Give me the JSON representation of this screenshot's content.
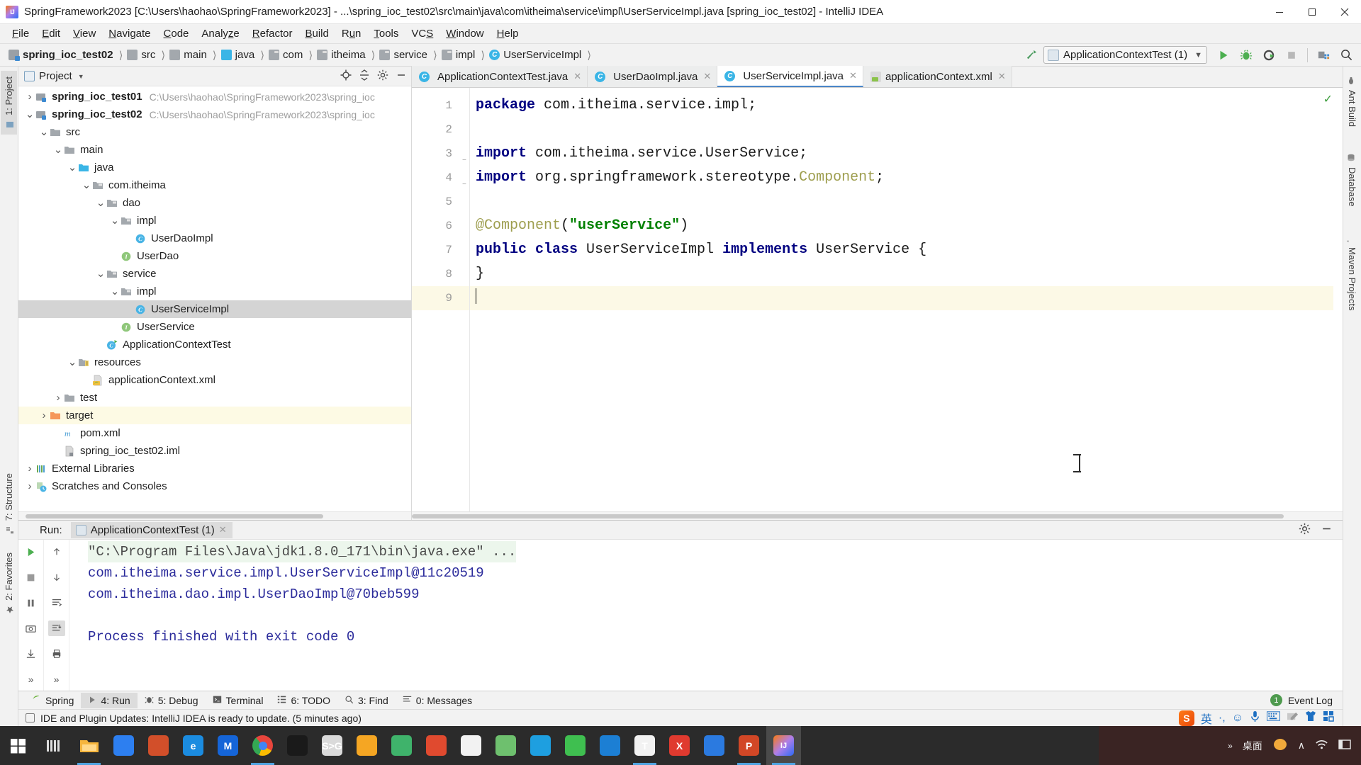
{
  "window": {
    "title": "SpringFramework2023 [C:\\Users\\haohao\\SpringFramework2023] - ...\\spring_ioc_test02\\src\\main\\java\\com\\itheima\\service\\impl\\UserServiceImpl.java [spring_ioc_test02] - IntelliJ IDEA",
    "logo_icon": "intellij-idea-logo",
    "minimize_icon": "minimize-icon",
    "maximize_icon": "maximize-icon",
    "close_icon": "close-icon"
  },
  "menu": [
    {
      "label": "File",
      "mnemonic": "F"
    },
    {
      "label": "Edit",
      "mnemonic": "E"
    },
    {
      "label": "View",
      "mnemonic": "V"
    },
    {
      "label": "Navigate",
      "mnemonic": "N"
    },
    {
      "label": "Code",
      "mnemonic": "C"
    },
    {
      "label": "Analyze",
      "mnemonic": "z"
    },
    {
      "label": "Refactor",
      "mnemonic": "R"
    },
    {
      "label": "Build",
      "mnemonic": "B"
    },
    {
      "label": "Run",
      "mnemonic": "u"
    },
    {
      "label": "Tools",
      "mnemonic": "T"
    },
    {
      "label": "VCS",
      "mnemonic": "S"
    },
    {
      "label": "Window",
      "mnemonic": "W"
    },
    {
      "label": "Help",
      "mnemonic": "H"
    }
  ],
  "navbar": {
    "breadcrumbs": [
      {
        "label": "spring_ioc_test02",
        "icon": "module-icon",
        "bold": true
      },
      {
        "label": "src",
        "icon": "folder-icon",
        "bold": false
      },
      {
        "label": "main",
        "icon": "folder-icon",
        "bold": false
      },
      {
        "label": "java",
        "icon": "source-folder-icon",
        "bold": false
      },
      {
        "label": "com",
        "icon": "package-icon",
        "bold": false
      },
      {
        "label": "itheima",
        "icon": "package-icon",
        "bold": false
      },
      {
        "label": "service",
        "icon": "package-icon",
        "bold": false
      },
      {
        "label": "impl",
        "icon": "package-icon",
        "bold": false
      },
      {
        "label": "UserServiceImpl",
        "icon": "class-icon",
        "bold": false
      }
    ],
    "build_icon": "hammer-icon",
    "run_config": {
      "name": "ApplicationContextTest (1)",
      "icon": "run-config-icon",
      "dropdown_icon": "chevron-down-icon"
    },
    "actions": [
      {
        "name": "run-button",
        "icon": "run-icon"
      },
      {
        "name": "debug-button",
        "icon": "debug-icon"
      },
      {
        "name": "run-with-coverage-button",
        "icon": "coverage-icon"
      },
      {
        "name": "stop-button",
        "icon": "stop-icon"
      },
      {
        "name": "project-structure-button",
        "icon": "project-structure-icon"
      },
      {
        "name": "search-everywhere-button",
        "icon": "search-icon"
      }
    ]
  },
  "left_rail": [
    {
      "label": "1: Project",
      "icon": "project-icon",
      "active": true
    },
    {
      "label": "7: Structure",
      "icon": "structure-icon",
      "active": false
    },
    {
      "label": "2: Favorites",
      "icon": "favorites-icon",
      "active": false
    }
  ],
  "right_rail": [
    {
      "label": "Ant Build",
      "icon": "ant-icon"
    },
    {
      "label": "Database",
      "icon": "database-icon"
    },
    {
      "label": "Maven Projects",
      "icon": "maven-icon"
    }
  ],
  "project_panel": {
    "title": "Project",
    "title_icon": "project-view-icon",
    "dropdown_icon": "chevron-down-icon",
    "actions": [
      {
        "name": "select-opened-file-button",
        "icon": "target-icon"
      },
      {
        "name": "collapse-all-button",
        "icon": "collapse-all-icon"
      },
      {
        "name": "settings-button",
        "icon": "gear-icon"
      },
      {
        "name": "hide-button",
        "icon": "minus-icon"
      }
    ],
    "tree": [
      {
        "label": "spring_ioc_test01",
        "path": "C:\\Users\\haohao\\SpringFramework2023\\spring_ioc",
        "indent": 0,
        "arrow": "collapsed",
        "icon": "module-icon",
        "bold": true,
        "state": "normal"
      },
      {
        "label": "spring_ioc_test02",
        "path": "C:\\Users\\haohao\\SpringFramework2023\\spring_ioc",
        "indent": 0,
        "arrow": "expanded",
        "icon": "module-icon",
        "bold": true,
        "state": "normal"
      },
      {
        "label": "src",
        "path": "",
        "indent": 1,
        "arrow": "expanded",
        "icon": "folder-icon",
        "bold": false,
        "state": "normal"
      },
      {
        "label": "main",
        "path": "",
        "indent": 2,
        "arrow": "expanded",
        "icon": "folder-icon",
        "bold": false,
        "state": "normal"
      },
      {
        "label": "java",
        "path": "",
        "indent": 3,
        "arrow": "expanded",
        "icon": "source-folder-icon",
        "bold": false,
        "state": "normal"
      },
      {
        "label": "com.itheima",
        "path": "",
        "indent": 4,
        "arrow": "expanded",
        "icon": "package-icon",
        "bold": false,
        "state": "normal"
      },
      {
        "label": "dao",
        "path": "",
        "indent": 5,
        "arrow": "expanded",
        "icon": "package-icon",
        "bold": false,
        "state": "normal"
      },
      {
        "label": "impl",
        "path": "",
        "indent": 6,
        "arrow": "expanded",
        "icon": "package-icon",
        "bold": false,
        "state": "normal"
      },
      {
        "label": "UserDaoImpl",
        "path": "",
        "indent": 7,
        "arrow": "none",
        "icon": "class-icon",
        "bold": false,
        "state": "normal"
      },
      {
        "label": "UserDao",
        "path": "",
        "indent": 6,
        "arrow": "none",
        "icon": "interface-icon",
        "bold": false,
        "state": "normal"
      },
      {
        "label": "service",
        "path": "",
        "indent": 5,
        "arrow": "expanded",
        "icon": "package-icon",
        "bold": false,
        "state": "normal"
      },
      {
        "label": "impl",
        "path": "",
        "indent": 6,
        "arrow": "expanded",
        "icon": "package-icon",
        "bold": false,
        "state": "normal"
      },
      {
        "label": "UserServiceImpl",
        "path": "",
        "indent": 7,
        "arrow": "none",
        "icon": "class-icon",
        "bold": false,
        "state": "selected"
      },
      {
        "label": "UserService",
        "path": "",
        "indent": 6,
        "arrow": "none",
        "icon": "interface-icon",
        "bold": false,
        "state": "normal"
      },
      {
        "label": "ApplicationContextTest",
        "path": "",
        "indent": 5,
        "arrow": "none",
        "icon": "runnable-class-icon",
        "bold": false,
        "state": "normal"
      },
      {
        "label": "resources",
        "path": "",
        "indent": 3,
        "arrow": "expanded",
        "icon": "resources-folder-icon",
        "bold": false,
        "state": "normal"
      },
      {
        "label": "applicationContext.xml",
        "path": "",
        "indent": 4,
        "arrow": "none",
        "icon": "spring-xml-icon",
        "bold": false,
        "state": "normal"
      },
      {
        "label": "test",
        "path": "",
        "indent": 2,
        "arrow": "collapsed",
        "icon": "folder-icon",
        "bold": false,
        "state": "normal"
      },
      {
        "label": "target",
        "path": "",
        "indent": 1,
        "arrow": "collapsed",
        "icon": "excluded-folder-icon",
        "bold": false,
        "state": "highlight"
      },
      {
        "label": "pom.xml",
        "path": "",
        "indent": 2,
        "arrow": "none",
        "icon": "maven-pom-icon",
        "bold": false,
        "state": "normal"
      },
      {
        "label": "spring_ioc_test02.iml",
        "path": "",
        "indent": 2,
        "arrow": "none",
        "icon": "iml-file-icon",
        "bold": false,
        "state": "normal"
      },
      {
        "label": "External Libraries",
        "path": "",
        "indent": 0,
        "arrow": "collapsed",
        "icon": "libraries-icon",
        "bold": false,
        "state": "normal"
      },
      {
        "label": "Scratches and Consoles",
        "path": "",
        "indent": 0,
        "arrow": "collapsed",
        "icon": "scratches-icon",
        "bold": false,
        "state": "normal"
      }
    ]
  },
  "editor": {
    "tabs": [
      {
        "label": "ApplicationContextTest.java",
        "icon": "runnable-class-icon",
        "active": false
      },
      {
        "label": "UserDaoImpl.java",
        "icon": "class-icon",
        "active": false
      },
      {
        "label": "UserServiceImpl.java",
        "icon": "class-icon",
        "active": true
      },
      {
        "label": "applicationContext.xml",
        "icon": "spring-xml-icon",
        "active": false
      }
    ],
    "inspection_icon": "inspection-ok-icon",
    "line_numbers": [
      "1",
      "2",
      "3",
      "4",
      "5",
      "6",
      "7",
      "8",
      "9"
    ],
    "current_line": 9,
    "lines": [
      {
        "n": 1,
        "tokens": [
          {
            "t": "package",
            "c": "kw"
          },
          {
            "t": " com.itheima.service.impl;",
            "c": "plain"
          }
        ],
        "fold": false
      },
      {
        "n": 2,
        "tokens": [],
        "fold": false
      },
      {
        "n": 3,
        "tokens": [
          {
            "t": "import",
            "c": "kw"
          },
          {
            "t": " com.itheima.service.UserService;",
            "c": "plain"
          }
        ],
        "fold": true
      },
      {
        "n": 4,
        "tokens": [
          {
            "t": "import",
            "c": "kw"
          },
          {
            "t": " org.springframework.stereotype.",
            "c": "plain"
          },
          {
            "t": "Component",
            "c": "ann"
          },
          {
            "t": ";",
            "c": "plain"
          }
        ],
        "fold": true
      },
      {
        "n": 5,
        "tokens": [],
        "fold": false
      },
      {
        "n": 6,
        "tokens": [
          {
            "t": "@Component",
            "c": "ann"
          },
          {
            "t": "(",
            "c": "plain"
          },
          {
            "t": "\"userService\"",
            "c": "str"
          },
          {
            "t": ")",
            "c": "plain"
          }
        ],
        "fold": false
      },
      {
        "n": 7,
        "tokens": [
          {
            "t": "public class",
            "c": "kw"
          },
          {
            "t": " UserServiceImpl ",
            "c": "plain"
          },
          {
            "t": "implements",
            "c": "kw"
          },
          {
            "t": " UserService {",
            "c": "plain"
          }
        ],
        "fold": false
      },
      {
        "n": 8,
        "tokens": [
          {
            "t": "}",
            "c": "plain"
          }
        ],
        "fold": false
      },
      {
        "n": 9,
        "tokens": [],
        "fold": false
      }
    ]
  },
  "run_panel": {
    "label": "Run:",
    "tab": {
      "label": "ApplicationContextTest (1)",
      "icon": "run-config-icon",
      "close_icon": "close-icon"
    },
    "header_actions": [
      {
        "name": "run-settings-button",
        "icon": "gear-icon"
      },
      {
        "name": "hide-run-panel-button",
        "icon": "minus-icon"
      }
    ],
    "left_buttons": [
      {
        "name": "rerun-button",
        "icon": "run-icon"
      },
      {
        "name": "stop-button",
        "icon": "stop-icon"
      },
      {
        "name": "pause-button",
        "icon": "pause-icon"
      },
      {
        "name": "screenshot-button",
        "icon": "camera-icon"
      },
      {
        "name": "export-button",
        "icon": "export-icon"
      },
      {
        "name": "more-button",
        "icon": "chevron-right-icon"
      }
    ],
    "right_buttons": [
      {
        "name": "up-stacktrace-button",
        "icon": "arrow-up-icon"
      },
      {
        "name": "down-stacktrace-button",
        "icon": "arrow-down-icon"
      },
      {
        "name": "soft-wrap-button",
        "icon": "wrap-icon"
      },
      {
        "name": "scroll-to-end-button",
        "icon": "scroll-end-icon"
      },
      {
        "name": "print-button",
        "icon": "print-icon"
      },
      {
        "name": "more-button",
        "icon": "chevron-right-icon"
      }
    ],
    "console_lines": [
      {
        "text": "\"C:\\Program Files\\Java\\jdk1.8.0_171\\bin\\java.exe\" ...",
        "style": "dim"
      },
      {
        "text": "com.itheima.service.impl.UserServiceImpl@11c20519",
        "style": "normal"
      },
      {
        "text": "com.itheima.dao.impl.UserDaoImpl@70beb599",
        "style": "normal"
      },
      {
        "text": "",
        "style": "normal"
      },
      {
        "text": "Process finished with exit code 0",
        "style": "normal"
      }
    ]
  },
  "bottom_tabs": [
    {
      "label": "Spring",
      "mnemonic": "",
      "icon": "spring-icon",
      "active": false
    },
    {
      "label": "4: Run",
      "mnemonic": "4",
      "icon": "run-icon",
      "active": true
    },
    {
      "label": "5: Debug",
      "mnemonic": "5",
      "icon": "debug-icon",
      "active": false
    },
    {
      "label": "Terminal",
      "mnemonic": "",
      "icon": "terminal-icon",
      "active": false
    },
    {
      "label": "6: TODO",
      "mnemonic": "6",
      "icon": "todo-icon",
      "active": false
    },
    {
      "label": "3: Find",
      "mnemonic": "3",
      "icon": "search-icon",
      "active": false
    },
    {
      "label": "0: Messages",
      "mnemonic": "0",
      "icon": "messages-icon",
      "active": false
    }
  ],
  "event_log": {
    "label": "Event Log",
    "count": "1",
    "icon": "event-log-icon"
  },
  "status_bar": {
    "message": "IDE and Plugin Updates: IntelliJ IDEA is ready to update. (5 minutes ago)",
    "icon": "notification-icon"
  },
  "ime_tray": {
    "logo": "sogou-ime-logo",
    "mode": "英",
    "items": [
      {
        "name": "punctuation-icon",
        "glyph": "·,"
      },
      {
        "name": "emoji-icon",
        "glyph": "☺"
      },
      {
        "name": "voice-input-icon",
        "glyph": " "
      },
      {
        "name": "keyboard-icon",
        "glyph": "⌨"
      },
      {
        "name": "handwriting-icon",
        "glyph": " "
      },
      {
        "name": "skin-icon",
        "glyph": " "
      },
      {
        "name": "toolbox-icon",
        "glyph": " "
      }
    ]
  },
  "taskbar": {
    "start_icon": "windows-start-icon",
    "task_view_icon": "task-view-icon",
    "apps": [
      {
        "name": "file-explorer",
        "glyph": "",
        "color": "#f5b53d",
        "running": true
      },
      {
        "name": "bluetooth-app",
        "glyph": "",
        "color": "#2d7ff0",
        "running": false
      },
      {
        "name": "media-app",
        "glyph": "",
        "color": "#d24f2a",
        "running": false
      },
      {
        "name": "edge-browser",
        "glyph": "e",
        "color": "#1b8ce0",
        "running": false
      },
      {
        "name": "meitu-app",
        "glyph": "M",
        "color": "#1565d8",
        "running": false
      },
      {
        "name": "chrome-browser",
        "glyph": "",
        "color": "#e8453c",
        "running": true
      },
      {
        "name": "terminal-app",
        "glyph": "",
        "color": "#1a1a1a",
        "running": false
      },
      {
        "name": "snipaste-app",
        "glyph": "S>G",
        "color": "#dadada",
        "running": false
      },
      {
        "name": "thunder-app",
        "glyph": "",
        "color": "#f5a623",
        "running": false
      },
      {
        "name": "netease-app",
        "glyph": "",
        "color": "#3fb36b",
        "running": false
      },
      {
        "name": "xmind-app",
        "glyph": "",
        "color": "#e04a2f",
        "running": false
      },
      {
        "name": "clock-app",
        "glyph": "",
        "color": "#f2f2f2",
        "running": false
      },
      {
        "name": "wechat-dev-app",
        "glyph": "",
        "color": "#6ec06e",
        "running": false
      },
      {
        "name": "qq-app",
        "glyph": "",
        "color": "#1e9fe0",
        "running": false
      },
      {
        "name": "wechat-app",
        "glyph": "",
        "color": "#3fbf50",
        "running": false
      },
      {
        "name": "qq-browser-app",
        "glyph": "",
        "color": "#1c7fd4",
        "running": false
      },
      {
        "name": "typora-app",
        "glyph": "T",
        "color": "#f2f2f2",
        "running": true
      },
      {
        "name": "xshell-app",
        "glyph": "X",
        "color": "#e03a2f",
        "running": false
      },
      {
        "name": "baidu-netdisk-app",
        "glyph": "",
        "color": "#2b7ae0",
        "running": false
      },
      {
        "name": "powerpoint-app",
        "glyph": "P",
        "color": "#d24726",
        "running": true
      },
      {
        "name": "intellij-idea-app",
        "glyph": "IJ",
        "color": "#2b2b2b",
        "running": true,
        "focused": true
      }
    ],
    "show_desktop_label": "桌面",
    "tray": [
      {
        "name": "expand-tray-icon",
        "glyph": "»"
      },
      {
        "name": "network-icon",
        "glyph": "◠"
      },
      {
        "name": "show-hidden-icons",
        "glyph": "∧"
      },
      {
        "name": "wifi-icon",
        "glyph": "◔"
      },
      {
        "name": "action-center-icon",
        "glyph": "▣"
      }
    ]
  },
  "colors": {
    "accent": "#4a86c8",
    "selection": "#d4d4d4",
    "keyword": "#000080",
    "string": "#008000",
    "annotation": "#9e9e4f",
    "console_text": "#2b2b9b",
    "highlight_row": "#fdfae4"
  }
}
